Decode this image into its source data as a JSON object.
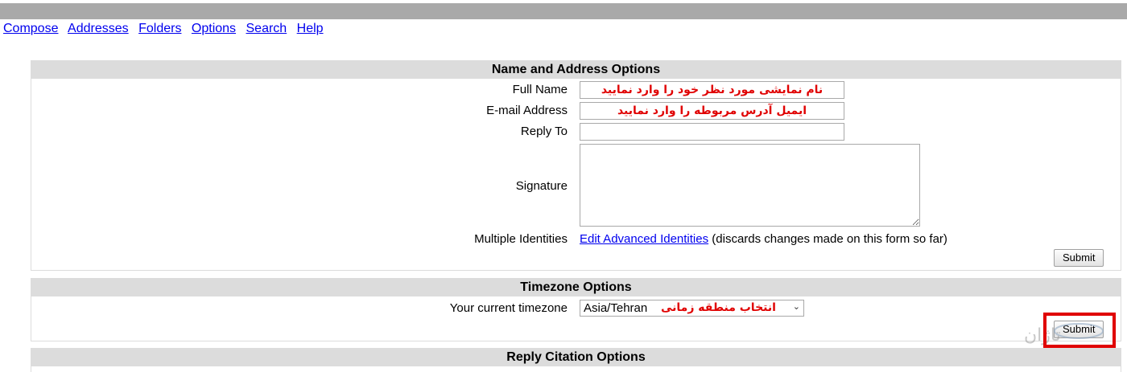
{
  "nav": [
    "Compose",
    "Addresses",
    "Folders",
    "Options",
    "Search",
    "Help"
  ],
  "name_address": {
    "title": "Name and Address Options",
    "full_name_label": "Full Name",
    "full_name_value": "نام نمایشی مورد نظر خود را وارد نمایید",
    "email_label": "E-mail Address",
    "email_value": "ایمیل آدرس مربوطه را وارد نمایید",
    "reply_to_label": "Reply To",
    "reply_to_value": "",
    "signature_label": "Signature",
    "signature_value": "",
    "identities_label": "Multiple Identities",
    "identities_link": "Edit Advanced Identities",
    "identities_note": "(discards changes made on this form so far)",
    "submit_label": "Submit"
  },
  "timezone": {
    "title": "Timezone Options",
    "label": "Your current timezone",
    "selected": "Asia/Tehran",
    "hint": "انتخاب منطقه زمانی",
    "submit_label": "Submit"
  },
  "next_section": {
    "title": "Reply Citation Options"
  },
  "colors": {
    "accent_red": "#e00000",
    "header_gray": "#dcdcdc",
    "link_blue": "#0000ee"
  }
}
